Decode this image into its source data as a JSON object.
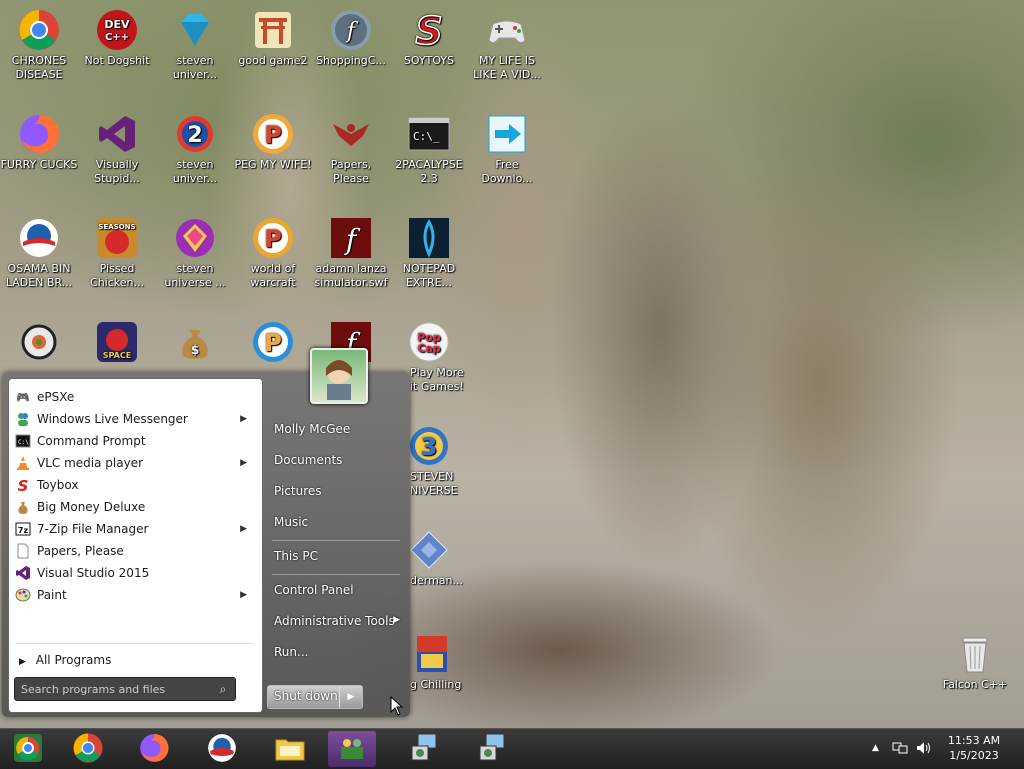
{
  "desktop_icons": [
    {
      "name": "chrome-icon",
      "label": "CHRONES DISEASE",
      "color": "#db4437"
    },
    {
      "name": "devcpp-icon",
      "label": "Not Dogshit",
      "color": "#c0161a"
    },
    {
      "name": "diamond-icon",
      "label": "steven univer...",
      "color": "#2fb6e8"
    },
    {
      "name": "gate-icon",
      "label": "good game2",
      "color": "#c74b2a"
    },
    {
      "name": "flash-icon",
      "label": "ShoppingC...",
      "color": "#6a7c8f"
    },
    {
      "name": "soytoys-icon",
      "label": "SOYTOYS",
      "color": "#e01b1b"
    },
    {
      "name": "gamepad-icon",
      "label": "MY LIFE IS LIKE A VID...",
      "color": "#e6e6e6"
    },
    {
      "name": "firefox-icon",
      "label": "FURRY CUCKS",
      "color": "#ff7139"
    },
    {
      "name": "visual-studio-icon",
      "label": "Visually Stupid...",
      "color": "#68217a"
    },
    {
      "name": "steven-2-icon",
      "label": "steven univer...",
      "color": "#e03a2e"
    },
    {
      "name": "peggle-icon",
      "label": "PEG MY WIFE!",
      "color": "#f2a83a"
    },
    {
      "name": "papers-please-icon",
      "label": "Papers, Please",
      "color": "#a82a24"
    },
    {
      "name": "cmd-icon",
      "label": "2PACALYPSE 2.3",
      "color": "#1b1b1b"
    },
    {
      "name": "free-download-icon",
      "label": "Free Downlo...",
      "color": "#16a6dd"
    },
    {
      "name": "obama-logo-icon",
      "label": "OSAMA BIN LADEN BR...",
      "color": "#1f5fb0"
    },
    {
      "name": "angry-birds-seasons-icon",
      "label": "Pissed Chicken...",
      "color": "#c9892e"
    },
    {
      "name": "steven-universe-icon",
      "label": "steven universe ...",
      "color": "#9a2fb5"
    },
    {
      "name": "peggle-wow-icon",
      "label": "world of warcraft",
      "color": "#e9a633"
    },
    {
      "name": "flash-swf-icon",
      "label": "adamn lanza simulator.swf",
      "color": "#6e0d0d"
    },
    {
      "name": "notepad-extreme-icon",
      "label": "NOTEPAD EXTRE...",
      "color": "#0b2033"
    },
    {
      "name": "sushi-icon",
      "label": "",
      "color": "#e9e9e9"
    },
    {
      "name": "angry-birds-space-icon",
      "label": "",
      "color": "#2b2b6b"
    },
    {
      "name": "money-bag-icon",
      "label": "",
      "color": "#b78b45"
    },
    {
      "name": "peggle-blue-icon",
      "label": "",
      "color": "#2a8fd8"
    },
    {
      "name": "flash-red-icon",
      "label": "",
      "color": "#6e0d0d"
    },
    {
      "name": "popcap-icon",
      "label": "Play More it Games!",
      "color": "#d6324a"
    },
    {
      "name": "steven-universe-3-icon",
      "label": "STEVEN NIVERSE 3",
      "color": "#2f74c7"
    },
    {
      "name": "map-icon",
      "label": "derman...",
      "color": "#5f84c9"
    },
    {
      "name": "chilling-icon",
      "label": "g Chilling",
      "color": "#d43a2a"
    },
    {
      "name": "recycle-bin-icon",
      "label": "Falcon C++",
      "color": "#d8d8d8"
    }
  ],
  "start_menu": {
    "programs": [
      {
        "name": "prog-epsxe",
        "label": "ePSXe",
        "icon": "gamepad-icon",
        "submenu": false
      },
      {
        "name": "prog-windows-live-messenger",
        "label": "Windows Live Messenger",
        "icon": "messenger-icon",
        "submenu": true
      },
      {
        "name": "prog-command-prompt",
        "label": "Command Prompt",
        "icon": "cmd-icon",
        "submenu": false
      },
      {
        "name": "prog-vlc",
        "label": "VLC media player",
        "icon": "vlc-cone-icon",
        "submenu": true
      },
      {
        "name": "prog-toybox",
        "label": "Toybox",
        "icon": "toybox-icon",
        "submenu": false
      },
      {
        "name": "prog-big-money",
        "label": "Big Money Deluxe",
        "icon": "money-bag-icon",
        "submenu": false
      },
      {
        "name": "prog-7zip",
        "label": "7-Zip File Manager",
        "icon": "7zip-icon",
        "submenu": true
      },
      {
        "name": "prog-papers-please",
        "label": "Papers, Please",
        "icon": "document-icon",
        "submenu": false
      },
      {
        "name": "prog-visual-studio",
        "label": "Visual Studio 2015",
        "icon": "visual-studio-icon",
        "submenu": false
      },
      {
        "name": "prog-paint",
        "label": "Paint",
        "icon": "paint-palette-icon",
        "submenu": true
      }
    ],
    "all_programs": "All Programs",
    "search_placeholder": "Search programs and files",
    "right_links": [
      {
        "name": "link-user",
        "label": "Molly McGee"
      },
      {
        "name": "link-documents",
        "label": "Documents"
      },
      {
        "name": "link-pictures",
        "label": "Pictures"
      },
      {
        "name": "link-music",
        "label": "Music"
      },
      {
        "name": "link-this-pc",
        "label": "This PC"
      },
      {
        "name": "link-control-panel",
        "label": "Control Panel"
      },
      {
        "name": "link-admin-tools",
        "label": "Administrative Tools"
      },
      {
        "name": "link-run",
        "label": "Run..."
      }
    ],
    "shutdown_label": "Shut down"
  },
  "taskbar": {
    "items": [
      {
        "name": "start-button",
        "icon": "start-orb-icon",
        "active": false
      },
      {
        "name": "taskbar-chrome",
        "icon": "chrome-icon",
        "active": false
      },
      {
        "name": "taskbar-firefox",
        "icon": "firefox-icon",
        "active": false
      },
      {
        "name": "taskbar-obama",
        "icon": "obama-logo-icon",
        "active": false
      },
      {
        "name": "taskbar-explorer",
        "icon": "folder-icon",
        "active": false
      },
      {
        "name": "taskbar-network",
        "icon": "network-users-icon",
        "active": true
      },
      {
        "name": "taskbar-installer-1",
        "icon": "installer-icon",
        "active": false
      },
      {
        "name": "taskbar-installer-2",
        "icon": "installer-icon",
        "active": false
      }
    ],
    "time": "11:53 AM",
    "date": "1/5/2023"
  }
}
